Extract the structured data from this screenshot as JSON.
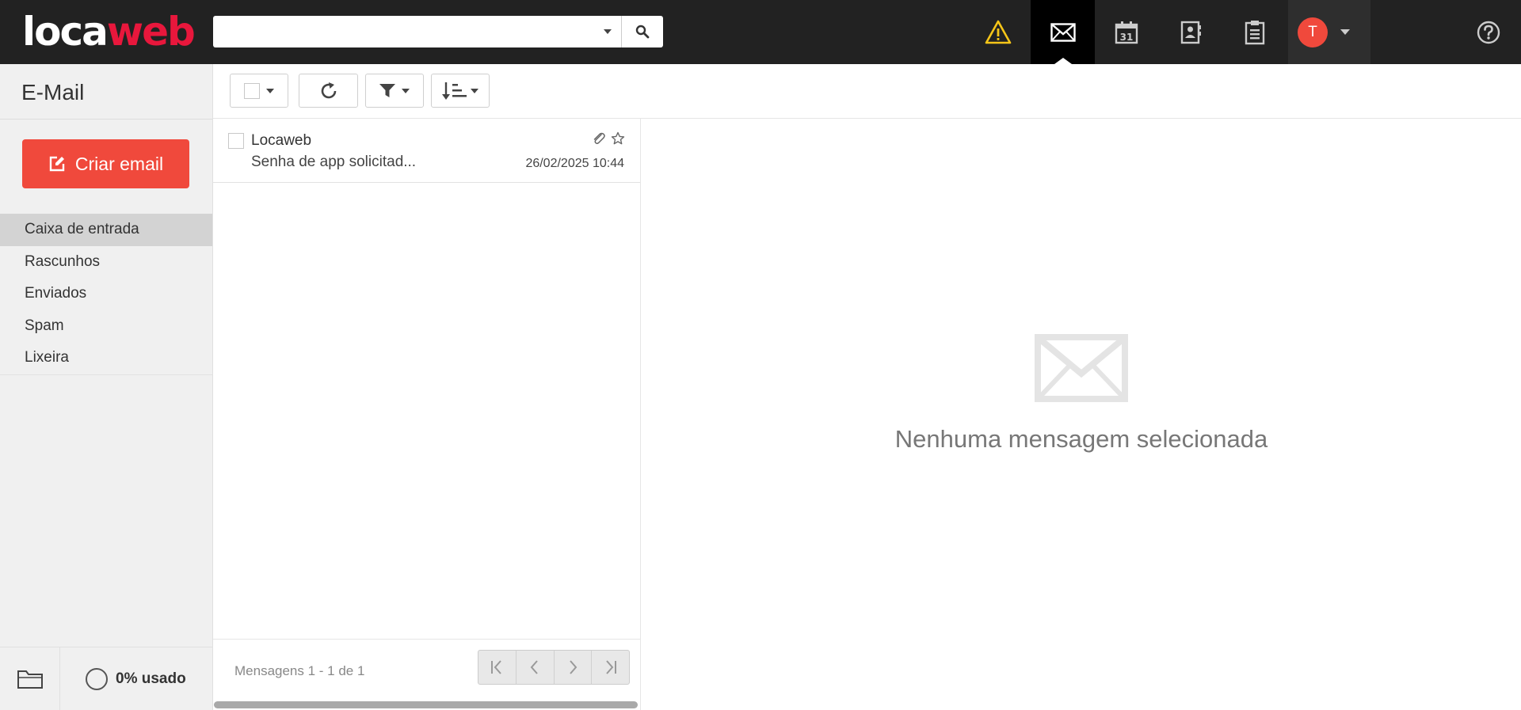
{
  "header": {
    "logo_part1": "loca",
    "logo_part2": "web",
    "search": {
      "value": "",
      "placeholder": ""
    },
    "nav": [
      "warning-icon",
      "mail-icon",
      "calendar-icon",
      "contacts-icon",
      "tasks-icon"
    ],
    "calendar_day": "31",
    "user_initial": "T",
    "help_icon": "help-icon"
  },
  "sidebar": {
    "title": "E-Mail",
    "compose_label": "Criar email",
    "folders": [
      {
        "label": "Caixa de entrada",
        "active": true
      },
      {
        "label": "Rascunhos"
      },
      {
        "label": "Enviados"
      },
      {
        "label": "Spam"
      },
      {
        "label": "Lixeira"
      }
    ],
    "quota": "0% usado"
  },
  "messages": [
    {
      "from": "Locaweb",
      "subject": "Senha de app solicitad...",
      "date": "26/02/2025 10:44",
      "has_attachment": true,
      "starred": false
    }
  ],
  "list_footer": {
    "count": "Mensagens 1 - 1 de 1"
  },
  "preview": {
    "empty_text": "Nenhuma mensagem selecionada"
  },
  "colors": {
    "accent": "#f0493c",
    "brand_red": "#e8173c",
    "topbar": "#222222",
    "warning": "#f5c518"
  }
}
